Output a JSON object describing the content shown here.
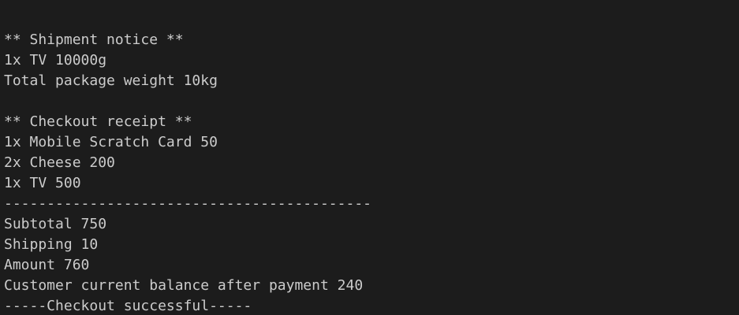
{
  "terminal": {
    "colors": {
      "background": "#1c1c1c",
      "text": "#cccccc"
    },
    "lines": [
      "** Shipment notice **",
      "1x TV 10000g",
      "Total package weight 10kg",
      "",
      "** Checkout receipt **",
      "1x Mobile Scratch Card 50",
      "2x Cheese 200",
      "1x TV 500",
      "-------------------------------------------",
      "Subtotal 750",
      "Shipping 10",
      "Amount 760",
      "Customer current balance after payment 240",
      "-----Checkout successful-----"
    ]
  }
}
